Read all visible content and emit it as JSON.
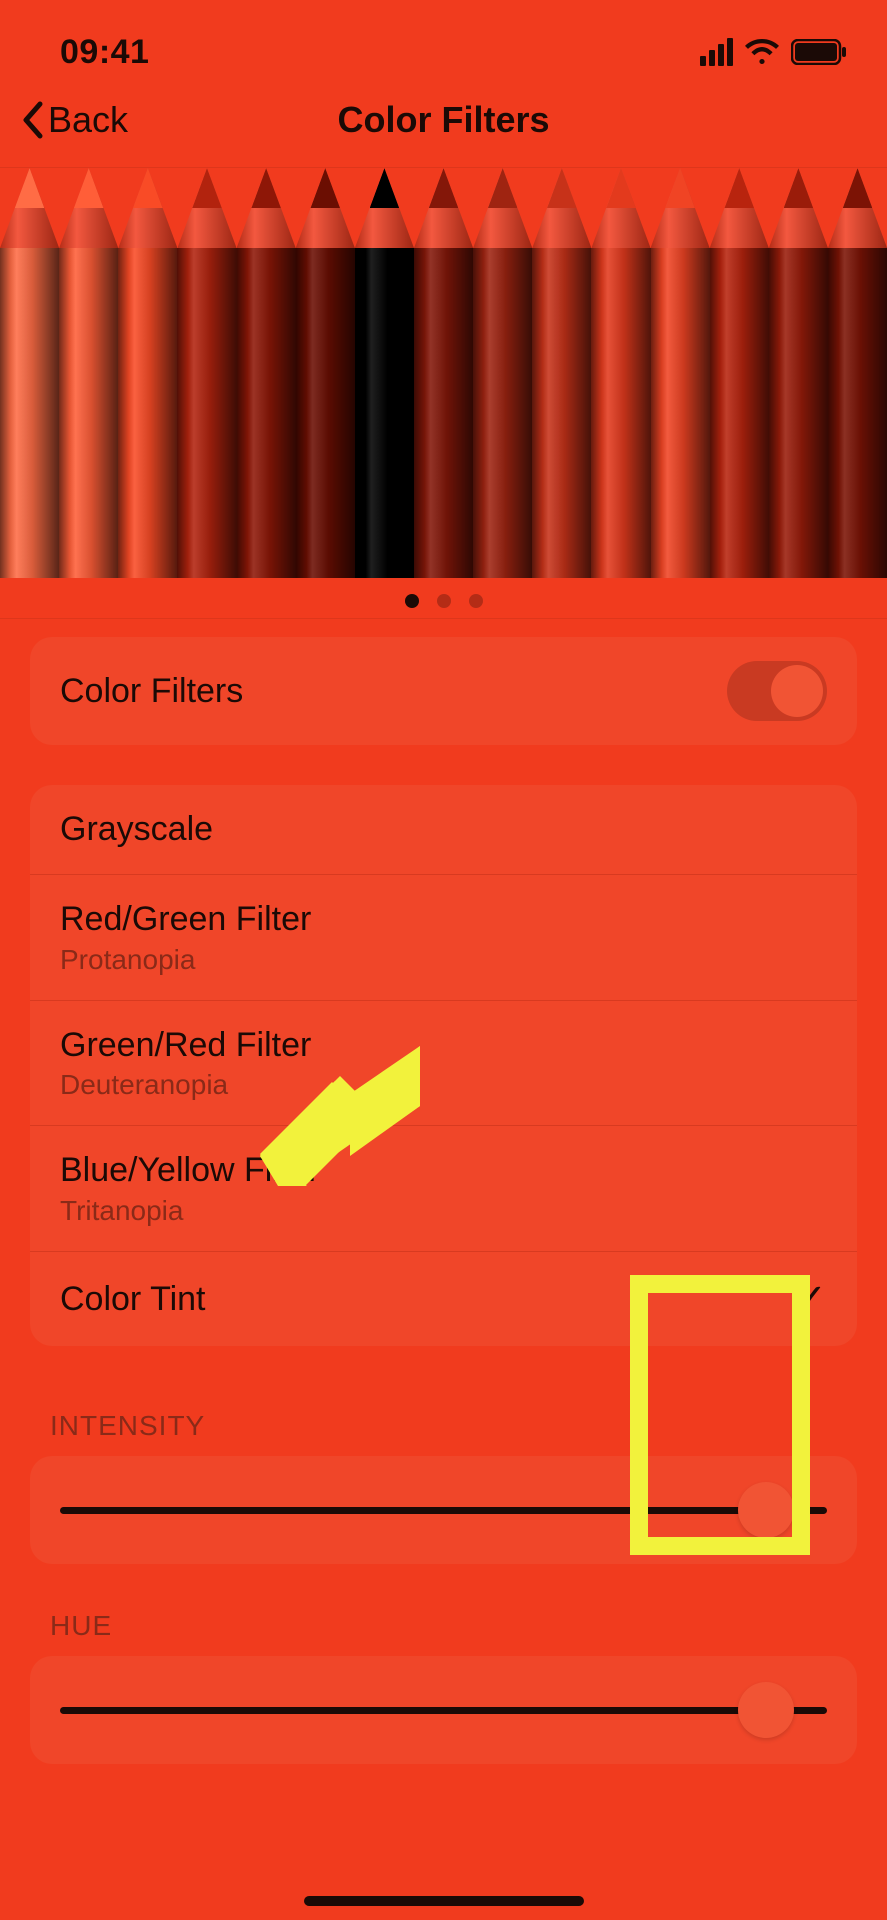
{
  "status": {
    "time": "09:41"
  },
  "nav": {
    "back": "Back",
    "title": "Color Filters"
  },
  "preview_pencils": [
    "#ff6c45",
    "#ff5e38",
    "#f94b26",
    "#b2230e",
    "#8e1707",
    "#6b0e02",
    "#000000",
    "#841709",
    "#9f2411",
    "#c73219",
    "#e33a1d",
    "#f04424",
    "#b8240e",
    "#9a1c0a",
    "#7c1305"
  ],
  "page_dots": {
    "count": 3,
    "active": 0
  },
  "toggle_row": {
    "label": "Color Filters",
    "on": true
  },
  "filters": [
    {
      "label": "Grayscale",
      "sub": "",
      "selected": false
    },
    {
      "label": "Red/Green Filter",
      "sub": "Protanopia",
      "selected": false
    },
    {
      "label": "Green/Red Filter",
      "sub": "Deuteranopia",
      "selected": false
    },
    {
      "label": "Blue/Yellow Filter",
      "sub": "Tritanopia",
      "selected": false
    },
    {
      "label": "Color Tint",
      "sub": "",
      "selected": true
    }
  ],
  "sliders": {
    "intensity": {
      "header": "INTENSITY",
      "value": 0.92
    },
    "hue": {
      "header": "HUE",
      "value": 0.92
    }
  }
}
